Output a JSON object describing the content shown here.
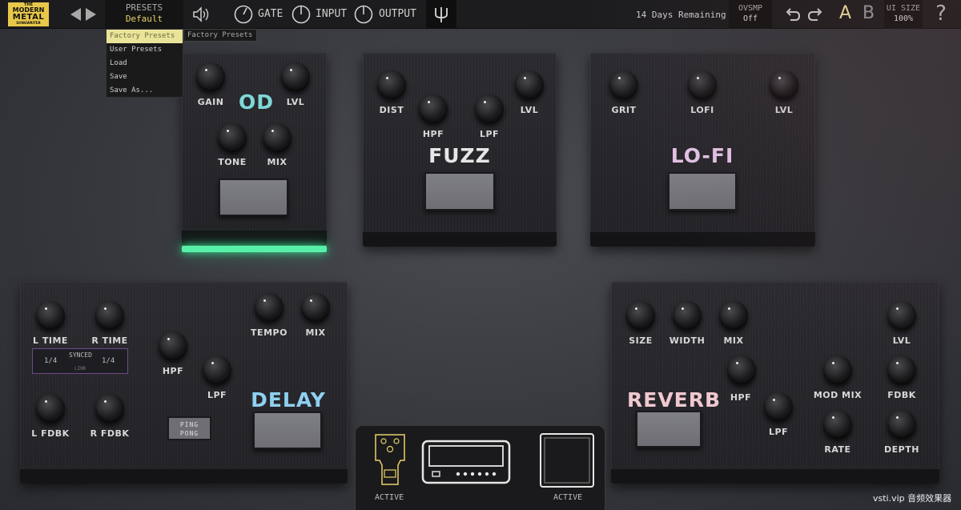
{
  "logo": {
    "line1": "THE",
    "line2": "MODERN",
    "line3": "METAL",
    "line4": "SONGWRITER"
  },
  "topbar": {
    "presets_label": "PRESETS",
    "presets_value": "Default",
    "gate_label": "GATE",
    "input_label": "INPUT",
    "output_label": "OUTPUT",
    "trial_text": "14 Days Remaining",
    "ovsmp_label": "OVSMP",
    "ovsmp_value": "Off",
    "a_label": "A",
    "b_label": "B",
    "ui_size_label": "UI SIZE",
    "ui_size_value": "100%",
    "help_label": "?"
  },
  "dropdown": {
    "items": [
      "Factory Presets",
      "User Presets",
      "Load",
      "Save",
      "Save As..."
    ],
    "submenu": "Factory Presets"
  },
  "od": {
    "title": "OD",
    "gain": "GAIN",
    "lvl": "LVL",
    "tone": "TONE",
    "mix": "MIX"
  },
  "fuzz": {
    "title": "FUZZ",
    "dist": "DIST",
    "hpf": "HPF",
    "lpf": "LPF",
    "lvl": "LVL"
  },
  "lofi": {
    "title": "LO-FI",
    "grit": "GRIT",
    "lofi": "LOFI",
    "lvl": "LVL"
  },
  "delay": {
    "title": "DELAY",
    "l_time": "L TIME",
    "r_time": "R TIME",
    "tempo": "TEMPO",
    "mix": "MIX",
    "hpf": "HPF",
    "lpf": "LPF",
    "l_fdbk": "L FDBK",
    "r_fdbk": "R FDBK",
    "sync_left": "1/4",
    "sync_label": "SYNCED",
    "sync_right": "1/4",
    "link_label": "LINK",
    "ping_line1": "PING",
    "ping_line2": "PONG"
  },
  "reverb": {
    "title": "REVERB",
    "size": "SIZE",
    "width": "WIDTH",
    "mix": "MIX",
    "lvl": "LVL",
    "hpf": "HPF",
    "mod_mix": "MOD MIX",
    "fdbk": "FDBK",
    "lpf": "LPF",
    "rate": "RATE",
    "depth": "DEPTH"
  },
  "chain": {
    "active_left": "ACTIVE",
    "active_right": "ACTIVE"
  },
  "watermark": "vsti.vip 音频效果器",
  "colors": {
    "accent_yellow": "#e8c84a",
    "led_green": "#58f0a8",
    "od_title": "#7fd8d8",
    "fuzz_title": "#e6e6e6",
    "lofi_title": "#e4c4e8",
    "delay_title": "#8fd0f0",
    "reverb_title": "#f0c8d0"
  }
}
